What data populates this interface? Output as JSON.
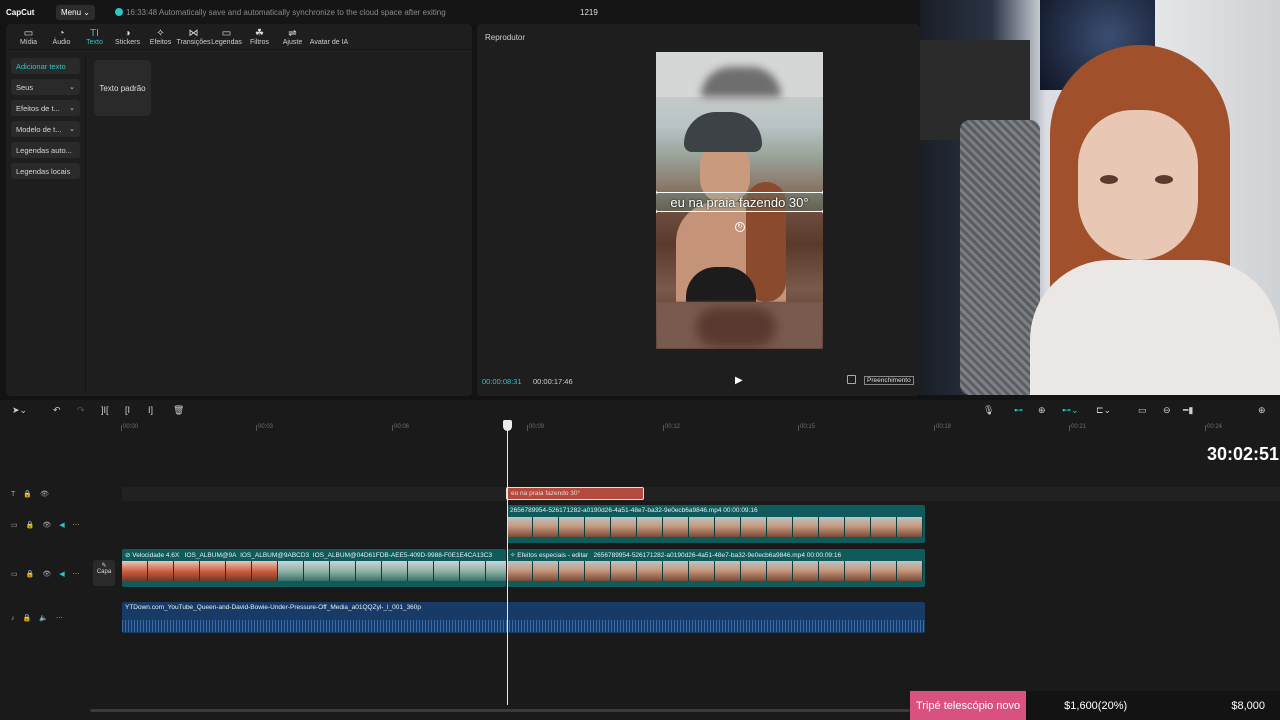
{
  "app": {
    "logo": "CapCut",
    "menu_label": "Menu",
    "save_status": "16:33:48 Automatically save and automatically synchronize to the cloud space after exiting",
    "project_name": "1219"
  },
  "toolbar": {
    "tabs": [
      {
        "label": "Mídia",
        "icon": "media-icon"
      },
      {
        "label": "Áudio",
        "icon": "audio-icon"
      },
      {
        "label": "Texto",
        "icon": "text-icon"
      },
      {
        "label": "Stickers",
        "icon": "sticker-icon"
      },
      {
        "label": "Efeitos",
        "icon": "effects-icon"
      },
      {
        "label": "Transições",
        "icon": "transitions-icon"
      },
      {
        "label": "Legendas",
        "icon": "captions-icon"
      },
      {
        "label": "Filtros",
        "icon": "filters-icon"
      },
      {
        "label": "Ajuste",
        "icon": "adjust-icon"
      },
      {
        "label": "Avatar de IA",
        "icon": "ai-avatar-icon"
      }
    ],
    "active_tab": "Texto",
    "accent_color": "#2ec4c4"
  },
  "sidebar": {
    "items": [
      {
        "label": "Adicionar texto"
      },
      {
        "label": "Seus"
      },
      {
        "label": "Efeitos de t..."
      },
      {
        "label": "Modelo de t..."
      },
      {
        "label": "Legendas auto..."
      },
      {
        "label": "Legendas locais"
      }
    ]
  },
  "text_panel": {
    "preset_label": "Texto padrão"
  },
  "player": {
    "title": "Reprodutor",
    "overlay_text": "eu na praia fazendo 30°",
    "current_time": "00:00:08:31",
    "total_time": "00:00:17:46",
    "fill_label": "Preenchimento"
  },
  "timeline": {
    "ruler_ticks": [
      "00:00",
      "00:03",
      "00:06",
      "00:09",
      "00:12",
      "00:15",
      "00:18",
      "00:21",
      "00:24"
    ],
    "cover_label": "Capa",
    "text_clip_label": "eu na praia fazendo 30°",
    "overlay_clip_label": "2656789954-526171282-a0190d26-4a51-48e7-ba32-9e0ecb6a9846.mp4   00:00:09:16",
    "main_clip_speed": "Velocidade 4.6X",
    "main_clip_labels": [
      "IOS_ALBUM@9A",
      "IOS_ALBUM@9ABCD3",
      "IOS_ALBUM@04D61FDB-AEE5-409D-9988-F0E1E4CA13C3"
    ],
    "main_clip_effects": "Efeitos especiais - editar",
    "main_clip_second_label": "2656789954-526171282-a0190d26-4a51-48e7-ba32-9e0ecb6a9846.mp4   00:00:09:16",
    "audio_clip_label": "YTDown.com_YouTube_Queen-and-David-Bowie-Under-Pressure-Off_Media_a01QQZyl-_l_001_360p"
  },
  "stream_overlay": {
    "clock": "30:02:51",
    "goal_label": "Tripé telescópio novo",
    "goal_progress": "$1,600(20%)",
    "goal_target": "$8,000"
  }
}
